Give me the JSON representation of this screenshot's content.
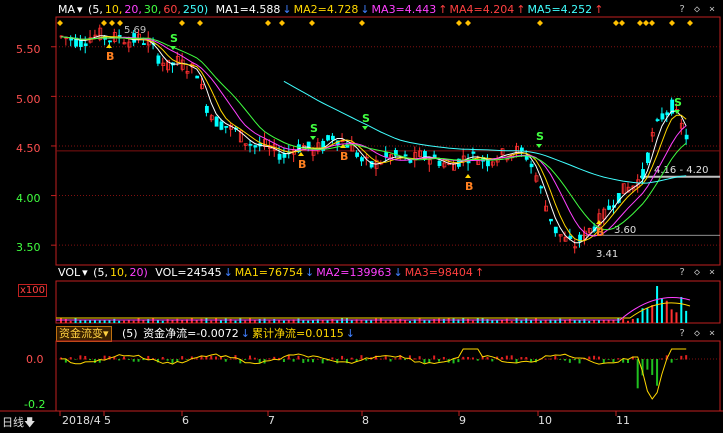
{
  "main_legend": {
    "indicator": "MA",
    "params": [
      "(5,",
      "10,",
      "20,",
      "30,",
      "60,",
      "250)"
    ],
    "param_colors": [
      "#ffffff",
      "#ffd700",
      "#ff40ff",
      "#40ff40",
      "#ff4040",
      "#40ffff"
    ],
    "values": [
      {
        "text": "MA1=4.588",
        "color": "#ffffff",
        "arrow": "↓",
        "arrow_color": "#4080ff"
      },
      {
        "text": "MA2=4.728",
        "color": "#ffd700",
        "arrow": "↓",
        "arrow_color": "#4080ff"
      },
      {
        "text": "MA3=4.443",
        "color": "#ff40ff",
        "arrow": "↑",
        "arrow_color": "#ff4040"
      },
      {
        "text": "MA4=4.204",
        "color": "#ff4040",
        "arrow": "↑",
        "arrow_color": "#ff4040"
      },
      {
        "text": "MA5=4.252",
        "color": "#40ffff",
        "arrow": "↑",
        "arrow_color": "#ff4040"
      }
    ]
  },
  "price_axis": [
    "5.50",
    "5.00",
    "4.50",
    "4.00",
    "3.50"
  ],
  "price_annotations": [
    "5.69",
    "4.16 - 4.20",
    "3.60",
    "3.41"
  ],
  "signals": [
    "B",
    "S"
  ],
  "vol_legend": {
    "indicator": "VOL",
    "params": [
      "(5,",
      "10,",
      "20)"
    ],
    "values": [
      {
        "text": "VOL=24545",
        "color": "#ffffff",
        "arrow": "↓",
        "arrow_color": "#4080ff"
      },
      {
        "text": "MA1=76754",
        "color": "#ffd700",
        "arrow": "↓",
        "arrow_color": "#4080ff"
      },
      {
        "text": "MA2=139963",
        "color": "#ff40ff",
        "arrow": "↓",
        "arrow_color": "#4080ff"
      },
      {
        "text": "MA3=98404",
        "color": "#ff4040",
        "arrow": "↑",
        "arrow_color": "#ff4040"
      }
    ]
  },
  "vol_unit": "x100",
  "fund_legend": {
    "selector": "资金流变",
    "param": "(5)",
    "values": [
      {
        "text": "资金净流=-0.0072",
        "color": "#ffffff",
        "arrow": "↓",
        "arrow_color": "#4080ff"
      },
      {
        "text": "累计净流=0.0115",
        "color": "#ffd700",
        "arrow": "↓",
        "arrow_color": "#4080ff"
      }
    ]
  },
  "fund_axis": [
    "0.0",
    "-0.2"
  ],
  "date_axis": {
    "period_button": "日线",
    "labels": [
      "2018/4",
      "5",
      "6",
      "7",
      "8",
      "9",
      "10",
      "11"
    ]
  },
  "panel_controls": [
    "?",
    "◇",
    "×"
  ],
  "colors": {
    "up": "#ff3030",
    "down": "#00ffff",
    "grid": "#801010",
    "axis": "#c02020"
  },
  "chart_data": {
    "type": "candlestick",
    "ylim": [
      3.3,
      5.8
    ],
    "ma_periods": [
      5,
      10,
      20,
      30,
      60,
      250
    ],
    "ma_last": {
      "MA1": 4.588,
      "MA2": 4.728,
      "MA3": 4.443,
      "MA4": 4.204,
      "MA5": 4.252
    },
    "x_months": [
      "2018/4",
      "5",
      "6",
      "7",
      "8",
      "9",
      "10",
      "11"
    ],
    "close_path": [
      5.6,
      5.58,
      5.55,
      5.6,
      5.62,
      5.58,
      5.6,
      5.56,
      5.58,
      5.55,
      5.4,
      5.3,
      5.35,
      5.3,
      5.25,
      4.9,
      4.75,
      4.7,
      4.65,
      4.55,
      4.5,
      4.5,
      4.45,
      4.4,
      4.48,
      4.5,
      4.45,
      4.5,
      4.6,
      4.55,
      4.5,
      4.35,
      4.3,
      4.35,
      4.4,
      4.38,
      4.35,
      4.4,
      4.38,
      4.35,
      4.3,
      4.35,
      4.4,
      4.38,
      4.35,
      4.4,
      4.42,
      4.45,
      4.4,
      4.2,
      3.9,
      3.65,
      3.55,
      3.5,
      3.6,
      3.7,
      3.8,
      3.95,
      4.05,
      4.1,
      4.2,
      4.6,
      4.8,
      4.9,
      4.7,
      4.5
    ],
    "annotations": {
      "high": 5.69,
      "range_low": 4.16,
      "range_high": 4.2,
      "support": 3.6,
      "low": 3.41
    }
  }
}
